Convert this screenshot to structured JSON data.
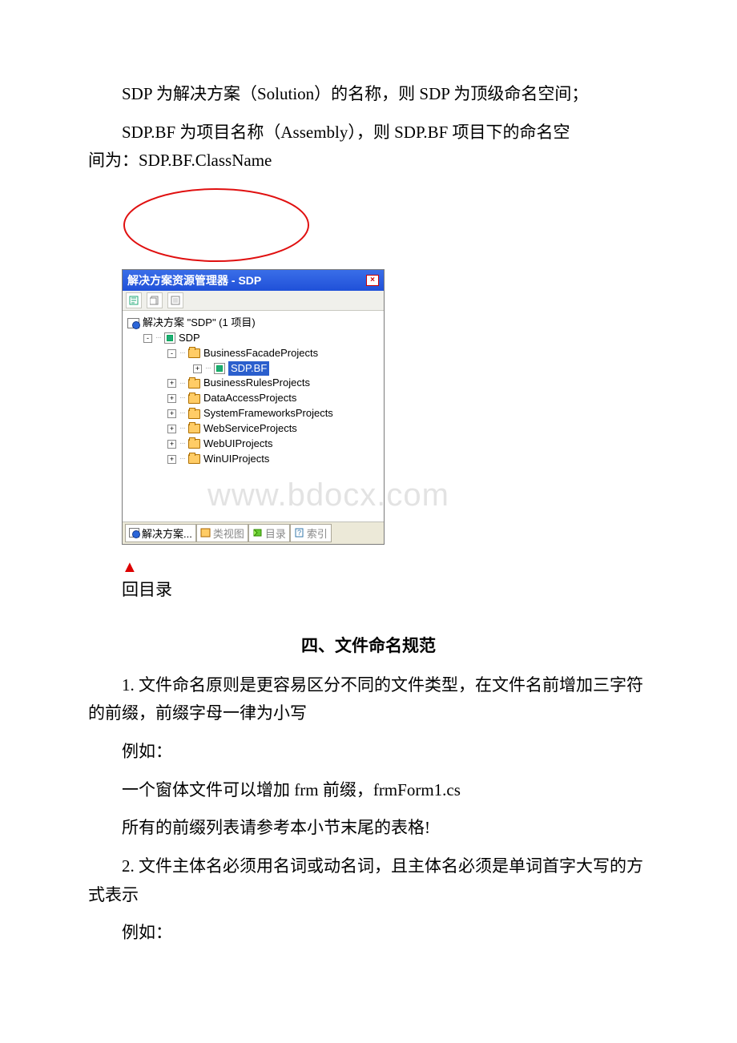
{
  "paragraphs": {
    "p1": "SDP 为解决方案（Solution）的名称，则 SDP 为顶级命名空间；",
    "p2a": "SDP.BF 为项目名称（Assembly），则 SDP.BF 项目下的命名空",
    "p2b": "间为：SDP.BF.ClassName"
  },
  "solution_explorer": {
    "title": "解决方案资源管理器 - SDP",
    "solution_label": "解决方案 \"SDP\" (1 项目)",
    "project": "SDP",
    "selected": "SDP.BF",
    "folders": {
      "f1": "BusinessFacadeProjects",
      "f2": "BusinessRulesProjects",
      "f3": "DataAccessProjects",
      "f4": "SystemFrameworksProjects",
      "f5": "WebServiceProjects",
      "f6": "WebUIProjects",
      "f7": "WinUIProjects"
    },
    "tabs": {
      "t1": "解决方案...",
      "t2": "类视图",
      "t3": "目录",
      "t4": "索引"
    }
  },
  "watermark": "www.bdocx.com",
  "back_link": "回目录",
  "section4": {
    "title": "四、文件命名规范",
    "p1": "1. 文件命名原则是更容易区分不同的文件类型，在文件名前增加三字符的前缀，前缀字母一律为小写",
    "p2": "例如：",
    "p3": "一个窗体文件可以增加 frm 前缀，frmForm1.cs",
    "p4": "所有的前缀列表请参考本小节末尾的表格!",
    "p5": "2. 文件主体名必须用名词或动名词，且主体名必须是单词首字大写的方式表示",
    "p6": "例如："
  }
}
